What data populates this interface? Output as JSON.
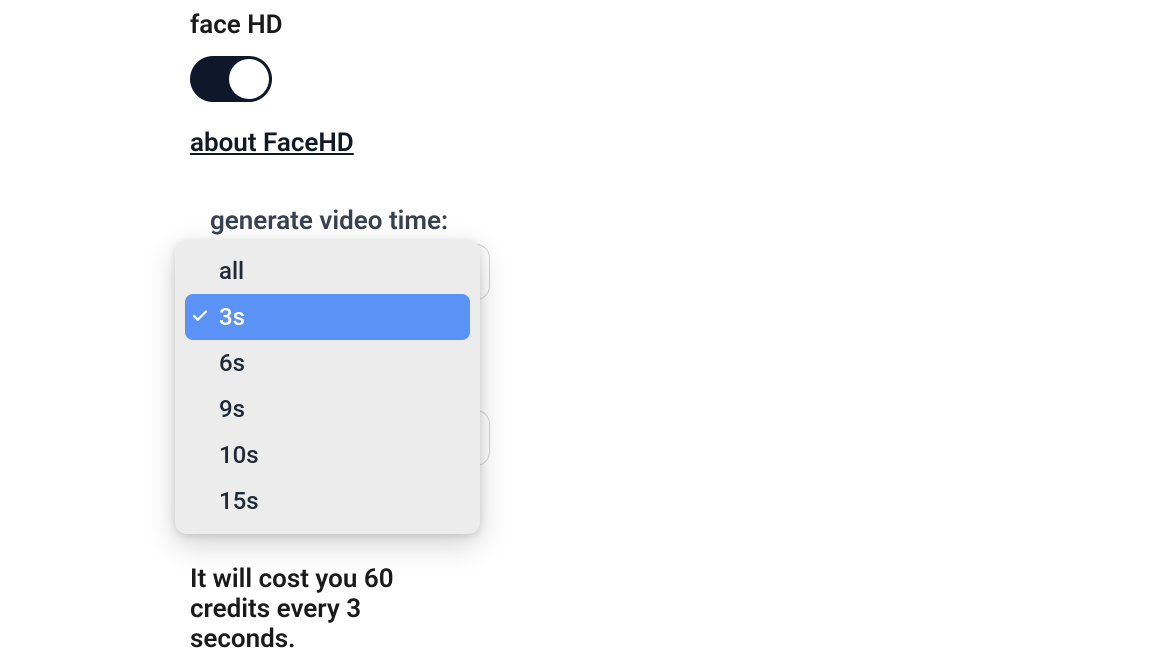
{
  "face_hd": {
    "label": "face HD",
    "toggle_on": true,
    "about_link": "about FaceHD"
  },
  "video_time": {
    "label": "generate video time:",
    "selected": "3s",
    "options": [
      "all",
      "3s",
      "6s",
      "9s",
      "10s",
      "15s"
    ]
  },
  "cost_text": "It will cost you 60 credits every 3 seconds."
}
